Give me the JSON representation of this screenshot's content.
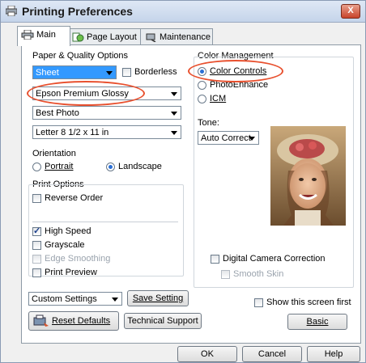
{
  "window": {
    "title": "Printing Preferences",
    "close_label": "X"
  },
  "tabs": [
    {
      "label": "Main",
      "icon": "printer-icon"
    },
    {
      "label": "Page Layout",
      "icon": "page-layout-icon"
    },
    {
      "label": "Maintenance",
      "icon": "maintenance-icon"
    }
  ],
  "paper_quality": {
    "group_label": "Paper & Quality Options",
    "source_value": "Sheet",
    "borderless_label": "Borderless",
    "paper_type_value": "Epson Premium Glossy",
    "quality_value": "Best Photo",
    "size_value": "Letter 8 1/2 x 11 in"
  },
  "orientation": {
    "label": "Orientation",
    "portrait": "Portrait",
    "landscape": "Landscape"
  },
  "print_options": {
    "label": "Print Options",
    "reverse_order": "Reverse Order",
    "high_speed": "High Speed",
    "grayscale": "Grayscale",
    "edge_smoothing": "Edge Smoothing",
    "print_preview": "Print Preview"
  },
  "color_management": {
    "label": "Color Management",
    "color_controls": "Color Controls",
    "photoenhance": "PhotoEnhance",
    "icm": "ICM",
    "tone_label": "Tone:",
    "tone_value": "Auto Correct",
    "digital_camera": "Digital Camera Correction",
    "smooth_skin": "Smooth Skin"
  },
  "footer": {
    "custom_settings": "Custom Settings",
    "save_setting": "Save Setting",
    "reset_defaults": "Reset Defaults",
    "technical_support": "Technical Support",
    "show_first": "Show this screen first",
    "basic": "Basic"
  },
  "dialog_buttons": {
    "ok": "OK",
    "cancel": "Cancel",
    "help": "Help"
  },
  "colors": {
    "highlight_circle": "#e8502e",
    "selection": "#3399ff"
  }
}
